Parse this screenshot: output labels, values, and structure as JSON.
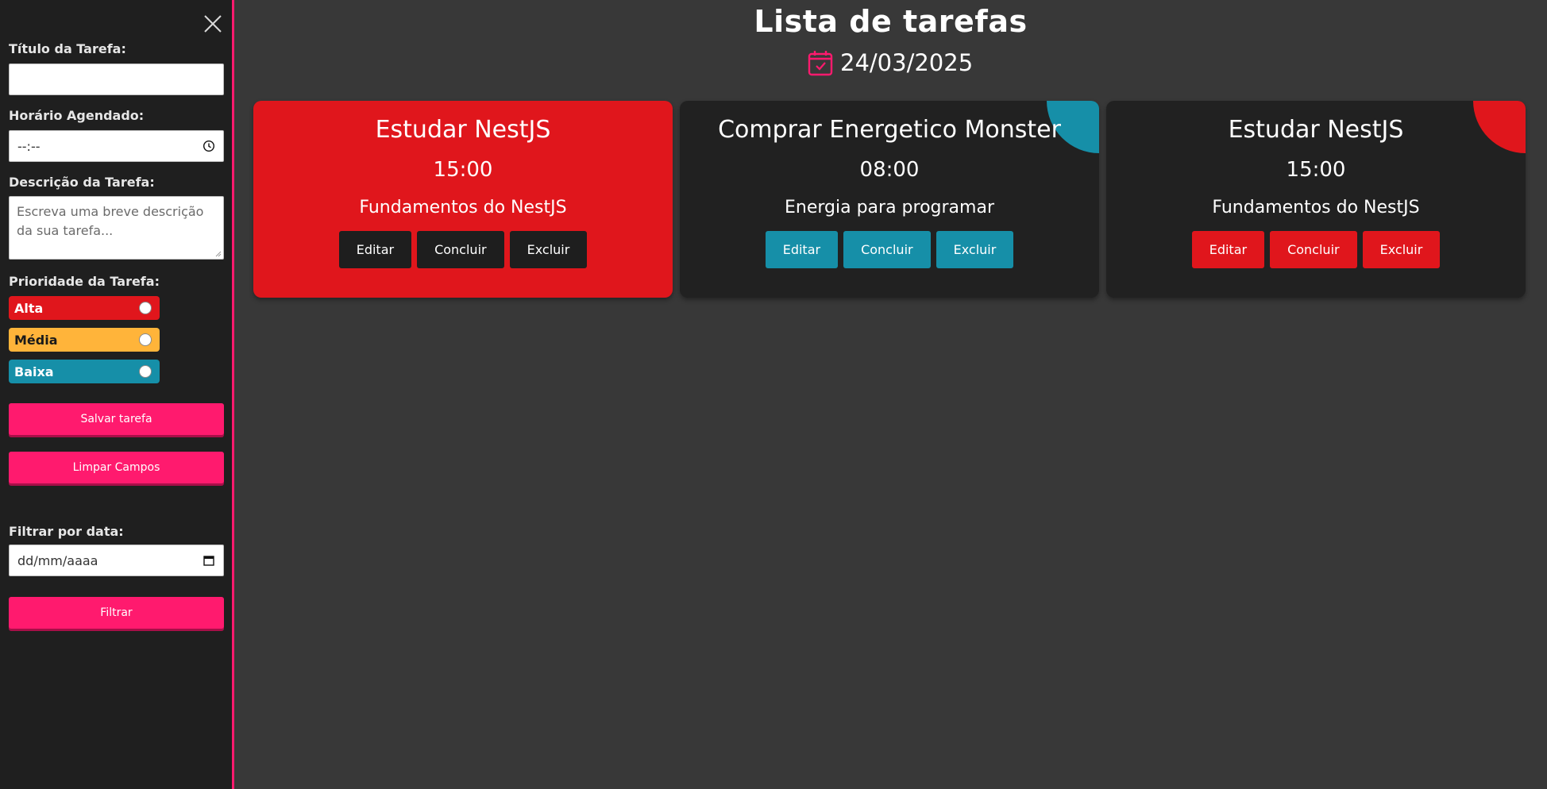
{
  "colors": {
    "accent": "#ff1a6e",
    "sidebar_bg": "#1f1f1f",
    "main_bg": "#383838",
    "card_dark": "#212121",
    "priority_high": "#e0161c",
    "priority_medium": "#ffb43a",
    "priority_low": "#168fa8",
    "button_dark": "#1e1e1e"
  },
  "sidebar": {
    "close_icon": "close-icon",
    "title_label": "Título da Tarefa:",
    "title_value": "",
    "time_label": "Horário Agendado:",
    "time_value": "--:--",
    "time_icon": "clock-icon",
    "description_label": "Descrição da Tarefa:",
    "description_placeholder": "Escreva uma breve descrição da sua tarefa...",
    "priority_label": "Prioridade da Tarefa:",
    "priorities": [
      {
        "label": "Alta",
        "color": "#e0161c",
        "text_color": "#ffffff"
      },
      {
        "label": "Média",
        "color": "#ffb43a",
        "text_color": "#1a1a1a"
      },
      {
        "label": "Baixa",
        "color": "#168fa8",
        "text_color": "#ffffff"
      }
    ],
    "save_button": "Salvar tarefa",
    "clear_button": "Limpar Campos",
    "filter_label": "Filtrar por data:",
    "filter_date_value": "dd/mm/aaaa",
    "filter_date_icon": "calendar-icon",
    "filter_button": "Filtrar"
  },
  "main": {
    "title": "Lista de tarefas",
    "date_icon": "calendar-check-icon",
    "date": "24/03/2025",
    "tasks": [
      {
        "title": "Estudar NestJS",
        "time": "15:00",
        "description": "Fundamentos do NestJS",
        "priority": "Alta",
        "edit_label": "Editar",
        "complete_label": "Concluir",
        "delete_label": "Excluir"
      },
      {
        "title": "Comprar Energetico Monster",
        "time": "08:00",
        "description": "Energia para programar",
        "priority": "Baixa",
        "edit_label": "Editar",
        "complete_label": "Concluir",
        "delete_label": "Excluir"
      },
      {
        "title": "Estudar NestJS",
        "time": "15:00",
        "description": "Fundamentos do NestJS",
        "priority": "Alta",
        "edit_label": "Editar",
        "complete_label": "Concluir",
        "delete_label": "Excluir"
      }
    ]
  }
}
